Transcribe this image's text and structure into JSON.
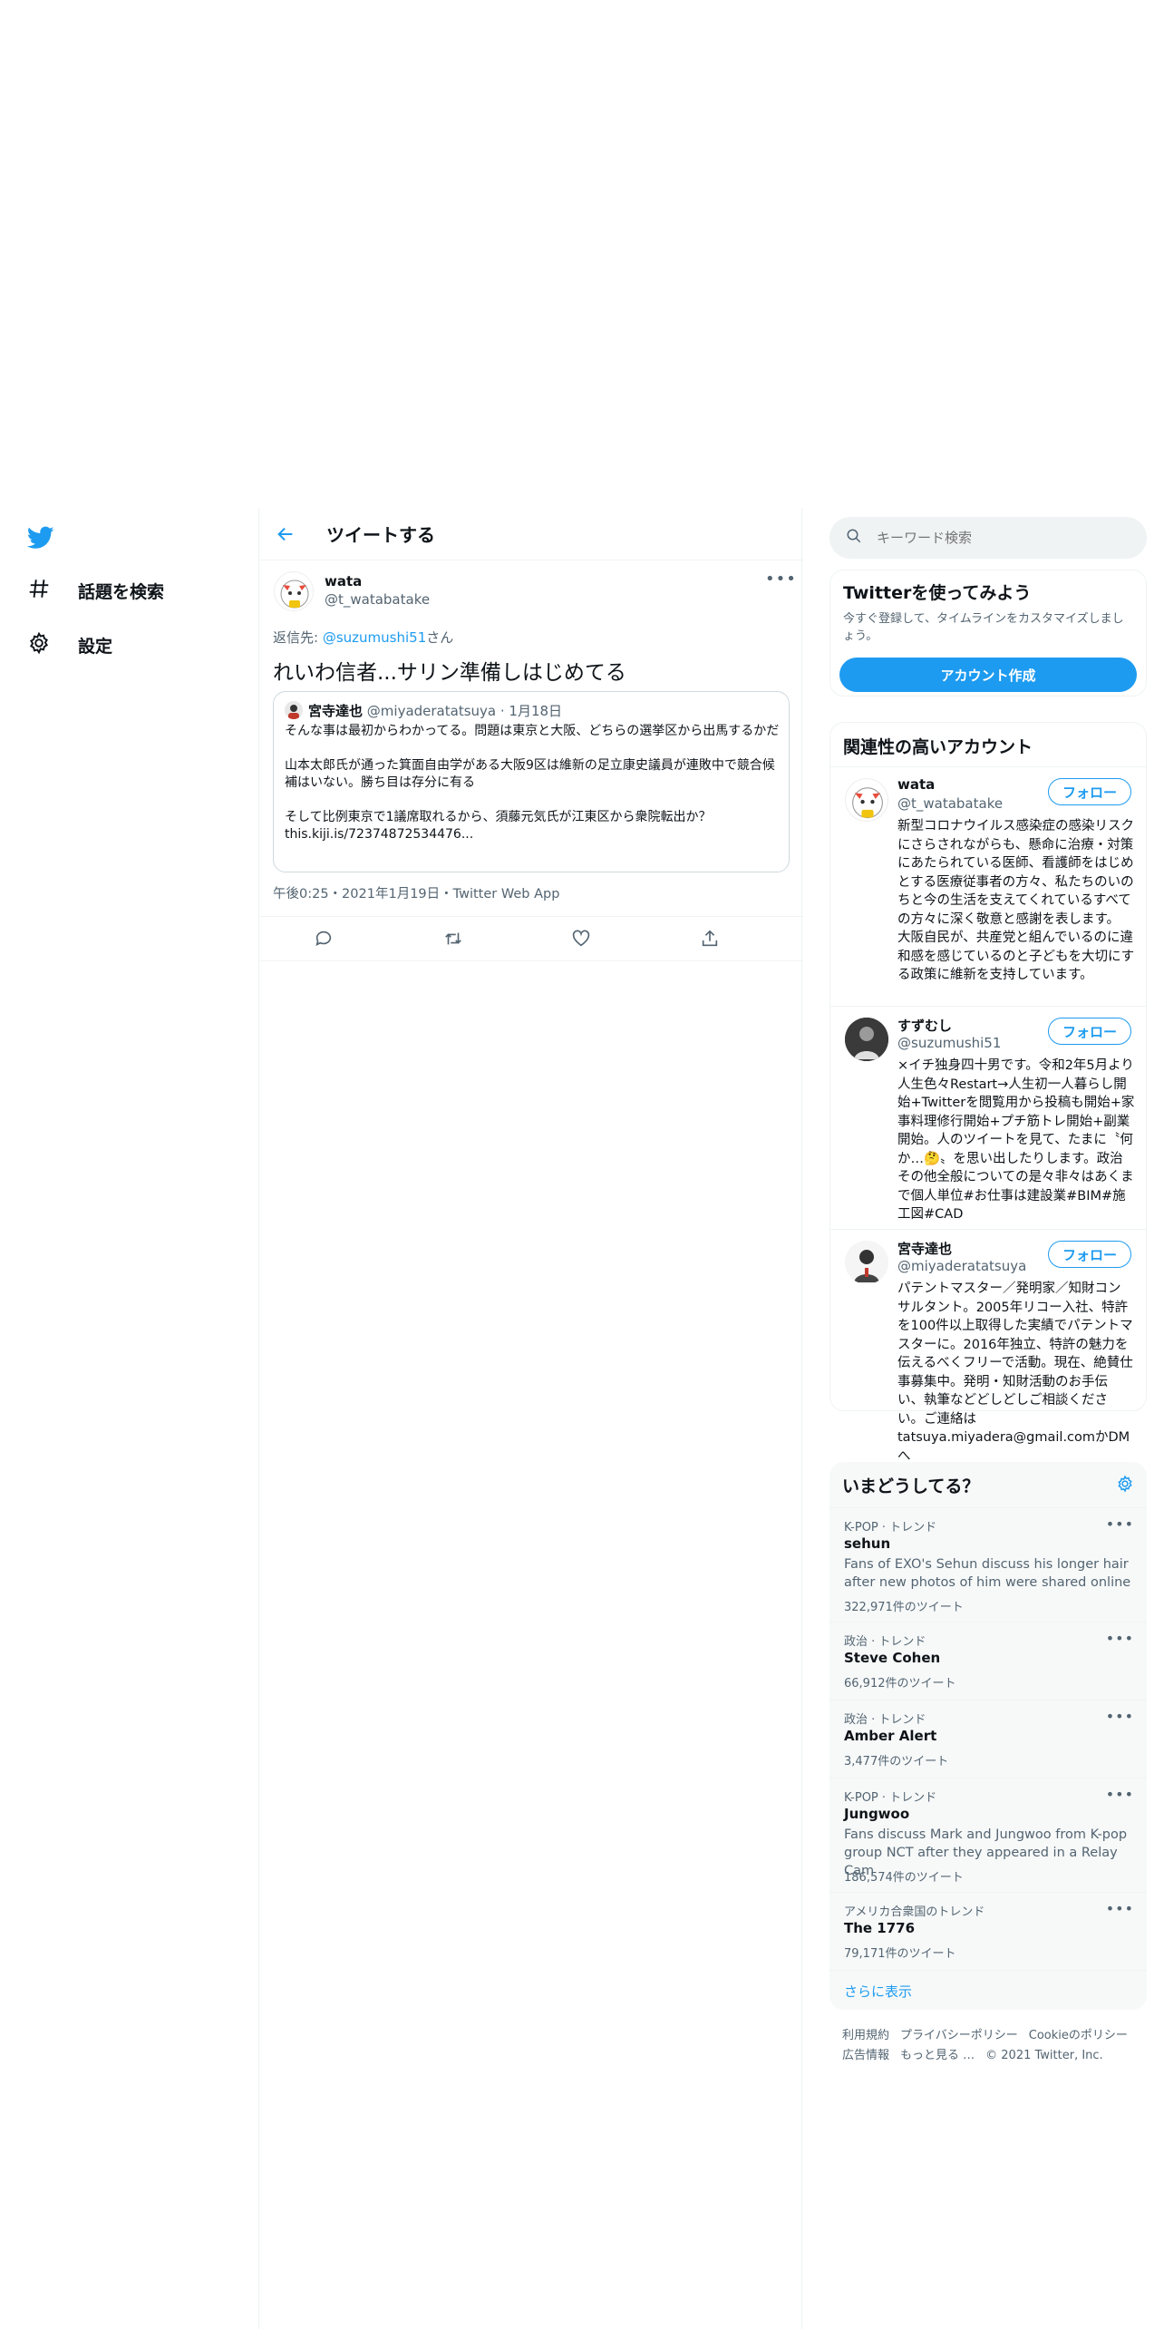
{
  "nav": {
    "items": [
      {
        "label": "話題を検索",
        "icon": "hash-icon"
      },
      {
        "label": "設定",
        "icon": "gear-icon"
      }
    ]
  },
  "header": {
    "title": "ツイートする"
  },
  "tweet": {
    "author_name": "wata",
    "author_handle": "@t_watabatake",
    "reply_prefix": "返信先:",
    "reply_to": "@suzumushi51",
    "reply_suffix": "さん",
    "text": "れいわ信者...サリン準備しはじめてる",
    "meta": "午後0:25・2021年1月19日・Twitter Web App",
    "quote": {
      "author_name": "宮寺達也",
      "author_handle": "@miyaderatatsuya",
      "date": "· 1月18日",
      "text": "そんな事は最初からわかってる。問題は東京と大阪、どちらの選挙区から出馬するかだ\n\n山本太郎氏が通った箕面自由学がある大阪9区は維新の足立康史議員が連敗中で競合候補はいない。勝ち目は存分に有る\n\nそして比例東京で1議席取れるから、須藤元気氏が江東区から衆院転出か？\nthis.kiji.is/72374872534476..."
    }
  },
  "search": {
    "placeholder": "キーワード検索"
  },
  "signup": {
    "title": "Twitterを使ってみよう",
    "desc": "今すぐ登録して、タイムラインをカスタマイズしましょう。",
    "button": "アカウント作成"
  },
  "related": {
    "title": "関連性の高いアカウント",
    "follow_label": "フォロー",
    "accounts": [
      {
        "name": "wata",
        "handle": "@t_watabatake",
        "bio": "新型コロナウイルス感染症の感染リスクにさらされながらも、懸命に治療・対策にあたられている医師、看護師をはじめとする医療従事者の方々、私たちのいのちと今の生活を支えてくれているすべての方々に深く敬意と感謝を表します。 大阪自民が、共産党と組んでいるのに違和感を感じているのと子どもを大切にする政策に維新を支持しています。"
      },
      {
        "name": "すずむし",
        "handle": "@suzumushi51",
        "bio": "×イチ独身四十男です。令和2年5月より人生色々Restart→人生初一人暮らし開始+Twitterを閲覧用から投稿も開始+家事料理修行開始+プチ筋トレ開始+副業開始。人のツイートを見て、たまに〝何か…🤔〟を思い出したりします。政治その他全般についての是々非々はあくまで個人単位#お仕事は建設業#BIM#施工図#CAD"
      },
      {
        "name": "宮寺達也",
        "handle": "@miyaderatatsuya",
        "bio": "パテントマスター／発明家／知財コンサルタント。2005年リコー入社、特許を100件以上取得した実績でパテントマスターに。2016年独立、特許の魅力を伝えるべくフリーで活動。現在、絶賛仕事募集中。発明・知財活動のお手伝い、執筆などどしどしご相談ください。ご連絡はtatsuya.miyadera@gmail.comかDMへ"
      }
    ]
  },
  "trends": {
    "title": "いまどうしてる？",
    "items": [
      {
        "category": "K-POP · トレンド",
        "name": "sehun",
        "desc": "Fans of EXO's Sehun discuss his longer hair after new photos of him were shared online",
        "count": "322,971件のツイート"
      },
      {
        "category": "政治 · トレンド",
        "name": "Steve Cohen",
        "desc": "",
        "count": "66,912件のツイート"
      },
      {
        "category": "政治 · トレンド",
        "name": "Amber Alert",
        "desc": "",
        "count": "3,477件のツイート"
      },
      {
        "category": "K-POP · トレンド",
        "name": "Jungwoo",
        "desc": "Fans discuss Mark and Jungwoo from K-pop group NCT after they appeared in a Relay Cam",
        "count": "186,574件のツイート"
      },
      {
        "category": "アメリカ合衆国のトレンド",
        "name": "The 1776",
        "desc": "",
        "count": "79,171件のツイート"
      }
    ],
    "show_more": "さらに表示"
  },
  "footer": {
    "links": [
      "利用規約",
      "プライバシーポリシー",
      "Cookieのポリシー",
      "広告情報",
      "もっと見る …"
    ],
    "copyright": "© 2021 Twitter, Inc."
  },
  "colors": {
    "accent": "#1d9bf0",
    "text": "#0f1419",
    "muted": "#536471",
    "border": "#eff3f4"
  }
}
